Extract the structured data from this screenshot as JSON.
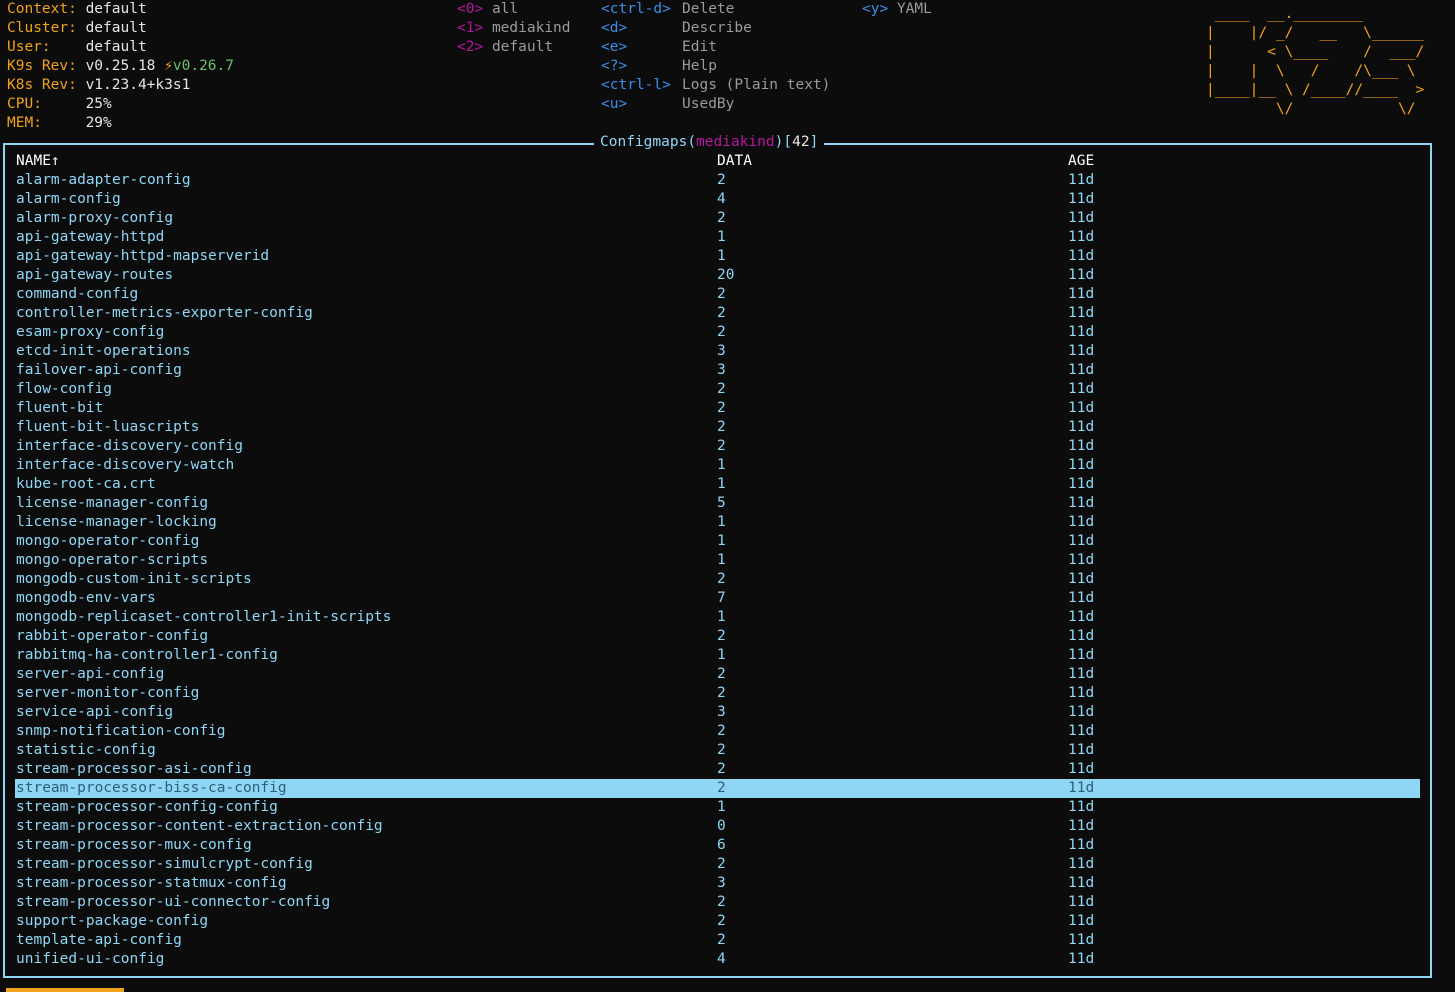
{
  "info": [
    {
      "label": "Context:",
      "value": "default"
    },
    {
      "label": "Cluster:",
      "value": "default"
    },
    {
      "label": "User:",
      "value": "default"
    },
    {
      "label": "K9s Rev:",
      "value": "v0.25.18",
      "extra": "v0.26.7"
    },
    {
      "label": "K8s Rev:",
      "value": "v1.23.4+k3s1"
    },
    {
      "label": "CPU:",
      "value": "25%"
    },
    {
      "label": "MEM:",
      "value": "29%"
    }
  ],
  "namespaces": [
    {
      "key": "<0>",
      "name": "all"
    },
    {
      "key": "<1>",
      "name": "mediakind"
    },
    {
      "key": "<2>",
      "name": "default"
    }
  ],
  "shortcuts": [
    {
      "key": "<ctrl-d>",
      "action": "Delete"
    },
    {
      "key": "<d>",
      "action": "Describe"
    },
    {
      "key": "<e>",
      "action": "Edit"
    },
    {
      "key": "<?>",
      "action": "Help"
    },
    {
      "key": "<ctrl-l>",
      "action": "Logs (Plain text)"
    },
    {
      "key": "<u>",
      "action": "UsedBy"
    }
  ],
  "shortcuts2": [
    {
      "key": "<y>",
      "action": "YAML"
    }
  ],
  "logo": " ____  __.________\n|    |/ _/   __   \\______\n|      < \\____    /  ___/\n|    |  \\   /    /\\___ \\\n|____|__ \\ /____//____  >\n        \\/            \\/",
  "panel": {
    "resource": "Configmaps",
    "open_paren": "(",
    "namespace": "mediakind",
    "close_paren": ")",
    "count_open": "[",
    "count": "42",
    "count_close": "]"
  },
  "table": {
    "headers": [
      "NAME↑",
      "DATA",
      "AGE"
    ],
    "selected_index": 32,
    "rows": [
      [
        "alarm-adapter-config",
        "2",
        "11d"
      ],
      [
        "alarm-config",
        "4",
        "11d"
      ],
      [
        "alarm-proxy-config",
        "2",
        "11d"
      ],
      [
        "api-gateway-httpd",
        "1",
        "11d"
      ],
      [
        "api-gateway-httpd-mapserverid",
        "1",
        "11d"
      ],
      [
        "api-gateway-routes",
        "20",
        "11d"
      ],
      [
        "command-config",
        "2",
        "11d"
      ],
      [
        "controller-metrics-exporter-config",
        "2",
        "11d"
      ],
      [
        "esam-proxy-config",
        "2",
        "11d"
      ],
      [
        "etcd-init-operations",
        "3",
        "11d"
      ],
      [
        "failover-api-config",
        "3",
        "11d"
      ],
      [
        "flow-config",
        "2",
        "11d"
      ],
      [
        "fluent-bit",
        "2",
        "11d"
      ],
      [
        "fluent-bit-luascripts",
        "2",
        "11d"
      ],
      [
        "interface-discovery-config",
        "2",
        "11d"
      ],
      [
        "interface-discovery-watch",
        "1",
        "11d"
      ],
      [
        "kube-root-ca.crt",
        "1",
        "11d"
      ],
      [
        "license-manager-config",
        "5",
        "11d"
      ],
      [
        "license-manager-locking",
        "1",
        "11d"
      ],
      [
        "mongo-operator-config",
        "1",
        "11d"
      ],
      [
        "mongo-operator-scripts",
        "1",
        "11d"
      ],
      [
        "mongodb-custom-init-scripts",
        "2",
        "11d"
      ],
      [
        "mongodb-env-vars",
        "7",
        "11d"
      ],
      [
        "mongodb-replicaset-controller1-init-scripts",
        "1",
        "11d"
      ],
      [
        "rabbit-operator-config",
        "2",
        "11d"
      ],
      [
        "rabbitmq-ha-controller1-config",
        "1",
        "11d"
      ],
      [
        "server-api-config",
        "2",
        "11d"
      ],
      [
        "server-monitor-config",
        "2",
        "11d"
      ],
      [
        "service-api-config",
        "3",
        "11d"
      ],
      [
        "snmp-notification-config",
        "2",
        "11d"
      ],
      [
        "statistic-config",
        "2",
        "11d"
      ],
      [
        "stream-processor-asi-config",
        "2",
        "11d"
      ],
      [
        "stream-processor-biss-ca-config",
        "2",
        "11d"
      ],
      [
        "stream-processor-config-config",
        "1",
        "11d"
      ],
      [
        "stream-processor-content-extraction-config",
        "0",
        "11d"
      ],
      [
        "stream-processor-mux-config",
        "6",
        "11d"
      ],
      [
        "stream-processor-simulcrypt-config",
        "2",
        "11d"
      ],
      [
        "stream-processor-statmux-config",
        "3",
        "11d"
      ],
      [
        "stream-processor-ui-connector-config",
        "2",
        "11d"
      ],
      [
        "support-package-config",
        "2",
        "11d"
      ],
      [
        "template-api-config",
        "2",
        "11d"
      ],
      [
        "unified-ui-config",
        "4",
        "11d"
      ]
    ]
  },
  "colors": {
    "background": "#0c0c0c",
    "label": "#f0a21b",
    "accent": "#8fd6f5",
    "namespace_key": "#b5179e",
    "shortcut_key": "#3b8eea",
    "selection_text": "#2b5f7a"
  }
}
